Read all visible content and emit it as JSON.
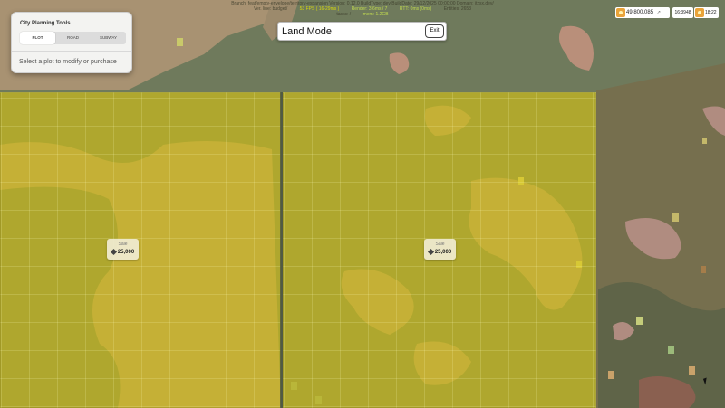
{
  "debug": {
    "line1": "Branch: feat/empty-envelope/territory-expansion Version: 0.12.0 BuildType: dev BuildDate: 29/12/2025 00:00:00 Domain: itzsx.dev/",
    "line2_label": "Ver. line: budget/",
    "fps": "53 FPS ( 16-29ms )",
    "render": "Render: 3.6ms / 7",
    "rtt": "RTT: 0ms (0ms)",
    "entities": "Entities: 2653",
    "line3_left": "tasks: /",
    "line3_mid": "mem: 1.2GB"
  },
  "tools_panel": {
    "title": "City Planning Tools",
    "tabs": [
      {
        "label": "PLOT",
        "active": true
      },
      {
        "label": "ROAD",
        "active": false
      },
      {
        "label": "SUBWAY",
        "active": false
      }
    ],
    "hint": "Select a plot to modify or purchase"
  },
  "mode_bar": {
    "title": "Land Mode",
    "exit_label": "Exit"
  },
  "hud": {
    "coins": "49,800,085",
    "level": "16:3948",
    "time": "18:22"
  },
  "plots": [
    {
      "status": "Sale",
      "price": "25,000"
    },
    {
      "status": "Sale",
      "price": "25,000"
    }
  ],
  "colors": {
    "plot_fill": "#d6c412",
    "terrain_green": "#6f7a5c",
    "terrain_sand": "#a89272",
    "accent_coin": "#e9a33a"
  }
}
